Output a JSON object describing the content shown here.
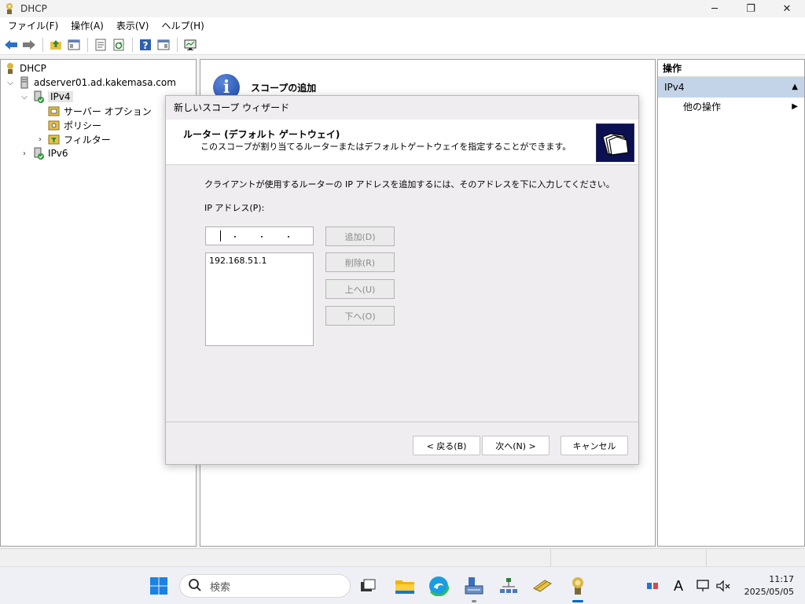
{
  "window": {
    "title": "DHCP"
  },
  "menu": [
    "ファイル(F)",
    "操作(A)",
    "表示(V)",
    "ヘルプ(H)"
  ],
  "tree": {
    "root": "DHCP",
    "server": "adserver01.ad.kakemasa.com",
    "ipv4": "IPv4",
    "server_options": "サーバー オプション",
    "policies": "ポリシー",
    "filters": "フィルター",
    "ipv6": "IPv6"
  },
  "center": {
    "title": "スコープの追加"
  },
  "actions": {
    "header": "操作",
    "section": "IPv4",
    "item": "他の操作"
  },
  "wizard": {
    "title": "新しいスコープ ウィザード",
    "header_title": "ルーター (デフォルト ゲートウェイ)",
    "header_desc": "このスコープが割り当てるルーターまたはデフォルトゲートウェイを指定することができます。",
    "instruction": "クライアントが使用するルーターの IP アドレスを追加するには、そのアドレスを下に入力してください。",
    "ip_label": "IP アドレス(P):",
    "ip_input_value": "",
    "ip_list": [
      "192.168.51.1"
    ],
    "buttons": {
      "add": "追加(D)",
      "remove": "削除(R)",
      "up": "上へ(U)",
      "down": "下へ(O)",
      "back": "< 戻る(B)",
      "next": "次へ(N) >",
      "cancel": "キャンセル"
    }
  },
  "taskbar": {
    "search_placeholder": "検索",
    "time": "11:17",
    "date": "2025/05/05"
  },
  "colors": {
    "accent": "#0067c0",
    "actions_section_bg": "#c4d4e8",
    "wizard_bg": "#f0edf0"
  }
}
